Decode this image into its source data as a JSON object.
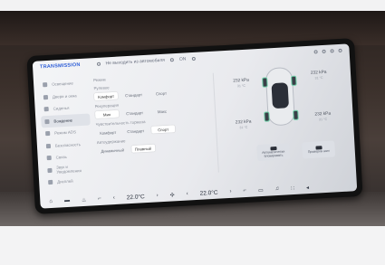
{
  "statusbar": {
    "logo": "TRANSMISSION",
    "car_label": "Не выходить из автомобиля",
    "icons": [
      "snow-icon",
      "fan-icon",
      "battery-icon"
    ],
    "status_text": "ON"
  },
  "sidebar": {
    "items": [
      {
        "label": "Освещение",
        "icon": "light-icon"
      },
      {
        "label": "Двери и окна",
        "icon": "door-icon"
      },
      {
        "label": "Сиденья",
        "icon": "seat-icon"
      },
      {
        "label": "Вождение",
        "icon": "steering-icon",
        "active": true
      },
      {
        "label": "Режим ADS",
        "icon": "adas-icon"
      },
      {
        "label": "Безопасность",
        "icon": "shield-icon"
      },
      {
        "label": "Связь",
        "icon": "link-icon"
      },
      {
        "label": "Звук и Уведомления",
        "icon": "sound-icon"
      },
      {
        "label": "Дисплей",
        "icon": "display-icon"
      }
    ]
  },
  "content": {
    "mode_title": "Режим",
    "steering_title": "Рулевое",
    "steering_options": [
      "Комфорт",
      "Стандарт",
      "Спорт"
    ],
    "regen_title": "Рекуперация",
    "regen_options": [
      "Мин",
      "Стандарт",
      "Макс"
    ],
    "brake_title": "Чувствительность тормоза",
    "brake_options": [
      "Комфорт",
      "Стандарт",
      "Спорт"
    ],
    "hold_title": "Автоудержание",
    "hold_options": [
      "Динамичный",
      "Плавный"
    ]
  },
  "tires": {
    "fl": {
      "value": "232 kPa",
      "temp": "31 °C"
    },
    "fr": {
      "value": "232 kPa",
      "temp": "31 °C"
    },
    "rl": {
      "value": "232 kPa",
      "temp": "31 °C"
    },
    "rr": {
      "value": "232 kPa",
      "temp": "31 °C"
    }
  },
  "cards": [
    {
      "label": "Автоматически блокировать"
    },
    {
      "label": "Проверка шин"
    }
  ],
  "dock": {
    "temp_left": "22.0",
    "temp_right": "22.0",
    "unit": "°C"
  }
}
